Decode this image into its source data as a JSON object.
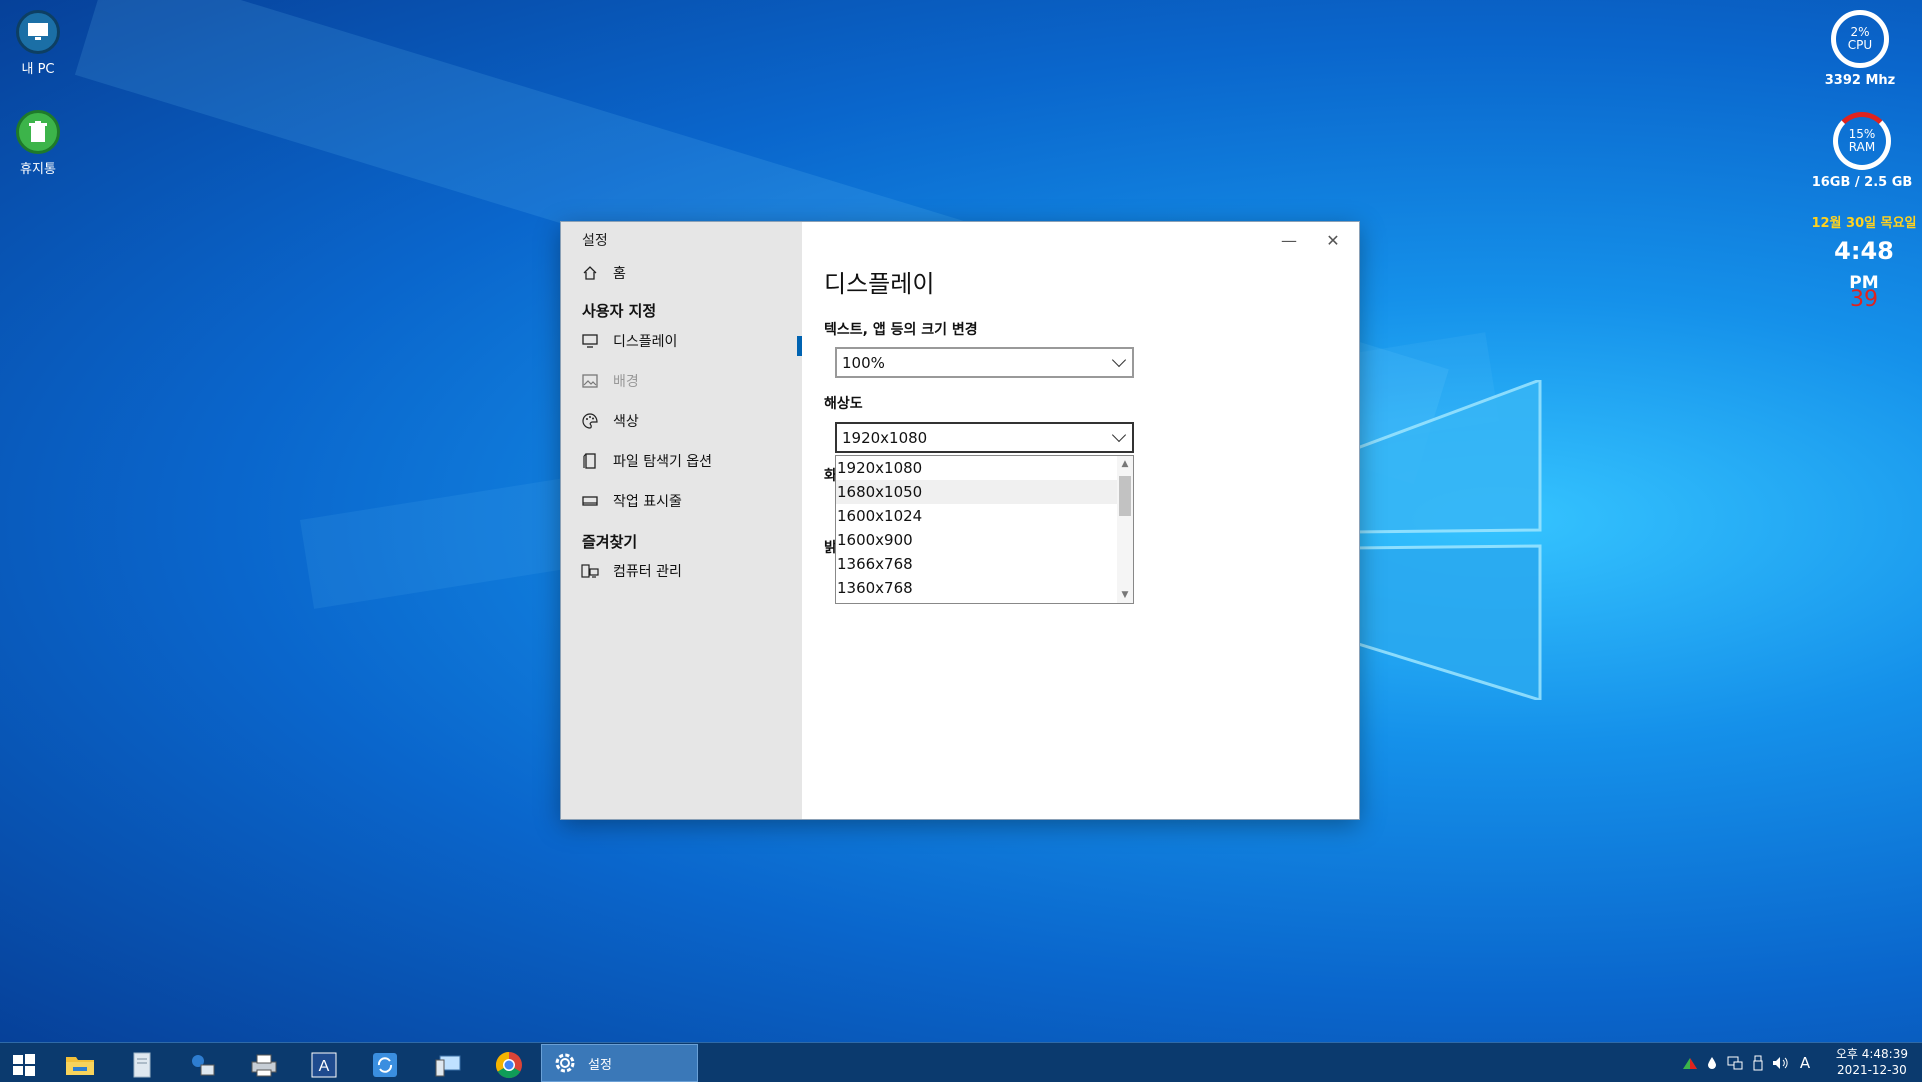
{
  "desktop": {
    "icons": [
      {
        "label": "내 PC",
        "icon": "computer-icon"
      },
      {
        "label": "휴지통",
        "icon": "recycle-bin-icon"
      }
    ]
  },
  "gadgets": {
    "cpu": {
      "value": "2%",
      "unit": "CPU",
      "caption": "3392 Mhz",
      "level": 0.02
    },
    "ram": {
      "value": "15%",
      "unit": "RAM",
      "caption": "16GB / 2.5 GB",
      "level": 0.15
    },
    "date": "12월 30일 목요일",
    "time": "4:48",
    "ampm": "PM",
    "seconds": "39"
  },
  "window": {
    "title": "설정",
    "controls": {
      "minimize": "—",
      "close": "✕"
    },
    "sidebar": {
      "home": "홈",
      "section1": "사용자 지정",
      "items": [
        {
          "label": "디스플레이",
          "icon": "monitor-icon",
          "selected": true
        },
        {
          "label": "배경",
          "icon": "picture-icon",
          "disabled": true
        },
        {
          "label": "색상",
          "icon": "palette-icon"
        },
        {
          "label": "파일 탐색기 옵션",
          "icon": "file-explorer-icon"
        },
        {
          "label": "작업 표시줄",
          "icon": "taskbar-icon"
        }
      ],
      "section2": "즐겨찾기",
      "favorites": [
        {
          "label": "컴퓨터 관리",
          "icon": "computer-management-icon"
        }
      ]
    },
    "main": {
      "page_title": "디스플레이",
      "scale_label": "텍스트, 앱 등의 크기 변경",
      "scale_value": "100%",
      "resolution_label": "해상도",
      "resolution_value": "1920x1080",
      "resolution_options": [
        "1920x1080",
        "1680x1050",
        "1600x1024",
        "1600x900",
        "1366x768",
        "1360x768"
      ],
      "peek1": "화",
      "peek2": "밝"
    }
  },
  "taskbar": {
    "active_app": "설정",
    "clock_time": "오후 4:48:39",
    "clock_date": "2021-12-30",
    "ime": "A"
  }
}
